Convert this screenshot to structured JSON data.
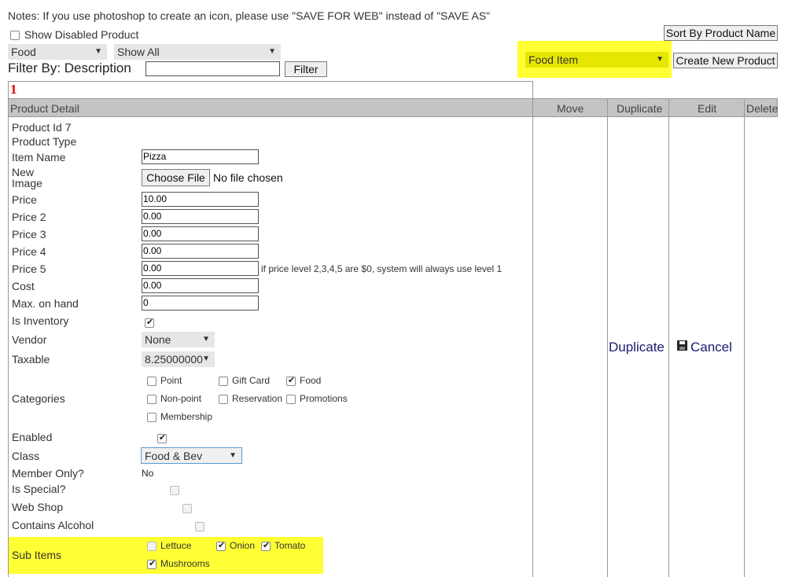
{
  "note": "Notes: If you use photoshop to create an icon, please use \"SAVE FOR WEB\" instead of \"SAVE AS\"",
  "show_disabled_label": "Show Disabled Product",
  "category_select": "Food",
  "show_select": "Show All",
  "filter_label": "Filter By: Description",
  "filter_value": "",
  "filter_button": "Filter",
  "sort_button": "Sort By Product Name",
  "type_select": "Food Item",
  "create_button": "Create New Product",
  "row_number": "1",
  "headers": {
    "detail": "Product Detail",
    "move": "Move",
    "duplicate": "Duplicate",
    "edit": "Edit",
    "delete": "Delete"
  },
  "product": {
    "id_label": "Product Id 7",
    "type_label": "Product Type",
    "item_name_label": "Item Name",
    "item_name": "Pizza",
    "new_image_label_1": "New",
    "new_image_label_2": "Image",
    "choose_file": "Choose File",
    "no_file": "No file chosen",
    "price_label": "Price",
    "price": "10.00",
    "price2_label": "Price 2",
    "price2": "0.00",
    "price3_label": "Price 3",
    "price3": "0.00",
    "price4_label": "Price 4",
    "price4": "0.00",
    "price5_label": "Price 5",
    "price5": "0.00",
    "price_note": "if price level 2,3,4,5 are $0, system will always use level 1",
    "cost_label": "Cost",
    "cost": "0.00",
    "max_label": "Max. on hand",
    "max": "0",
    "inventory_label": "Is Inventory",
    "vendor_label": "Vendor",
    "vendor": "None",
    "taxable_label": "Taxable",
    "taxable": "8.25000000",
    "categories_label": "Categories",
    "categories": {
      "point": "Point",
      "gift_card": "Gift Card",
      "food": "Food",
      "non_point": "Non-point",
      "reservation": "Reservation",
      "promotions": "Promotions",
      "membership": "Membership"
    },
    "enabled_label": "Enabled",
    "class_label": "Class",
    "class": "Food & Bev",
    "member_only_label": "Member Only?",
    "member_only": "No",
    "special_label": "Is Special?",
    "webshop_label": "Web Shop",
    "alcohol_label": "Contains Alcohol",
    "sub_items_label": "Sub Items",
    "sub_items": {
      "lettuce": "Lettuce",
      "onion": "Onion",
      "tomato": "Tomato",
      "mushrooms": "Mushrooms"
    }
  },
  "actions": {
    "duplicate": "Duplicate",
    "cancel": "Cancel"
  },
  "colors": {
    "highlight": "#ffff33",
    "row_number": "#e00000",
    "header_bg": "#c4c4c4"
  }
}
